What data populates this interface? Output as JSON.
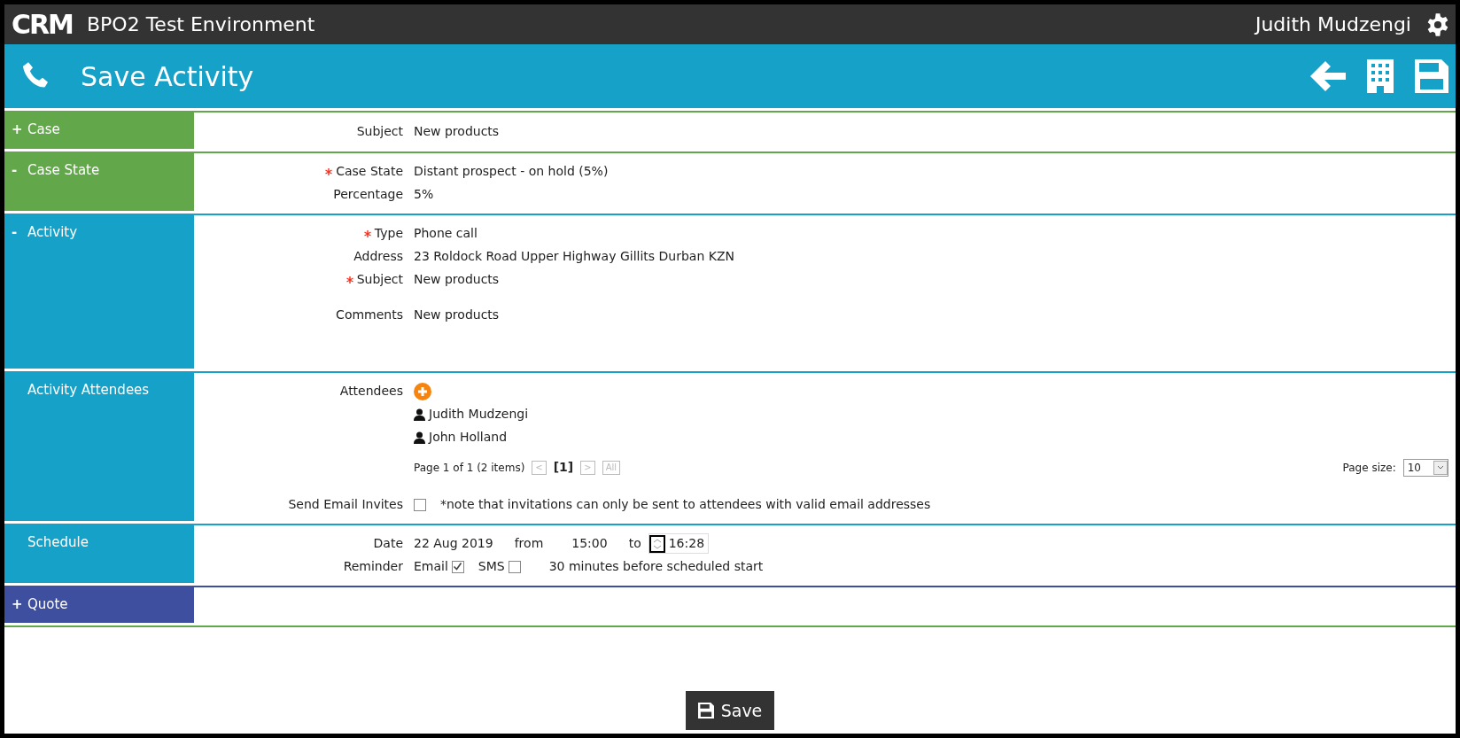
{
  "header": {
    "logo": "CRM",
    "environment": "BPO2 Test Environment",
    "user": "Judith Mudzengi"
  },
  "title_bar": {
    "title": "Save Activity"
  },
  "sections": [
    {
      "title": "Case",
      "toggle": "+",
      "color": "#62a84a",
      "rows": [
        {
          "kind": "field",
          "label": "Subject",
          "required": false,
          "value": "New products"
        }
      ]
    },
    {
      "title": "Case State",
      "toggle": "-",
      "color": "#62a84a",
      "rows": [
        {
          "kind": "field",
          "label": "Case State",
          "required": true,
          "value": "Distant prospect - on hold (5%)"
        },
        {
          "kind": "field",
          "label": "Percentage",
          "required": false,
          "value": "5%"
        }
      ]
    },
    {
      "title": "Activity",
      "toggle": "-",
      "color": "#16a1c9",
      "rows": [
        {
          "kind": "field",
          "label": "Type",
          "required": true,
          "value": "Phone call"
        },
        {
          "kind": "field",
          "label": "Address",
          "required": false,
          "value": "23 Roldock Road Upper Highway Gillits Durban KZN"
        },
        {
          "kind": "field",
          "label": "Subject",
          "required": true,
          "value": "New products"
        },
        {
          "kind": "multiline",
          "label": "Comments",
          "required": false,
          "value": "New products"
        }
      ]
    },
    {
      "title": "Activity Attendees",
      "color": "#16a1c9",
      "rows": [
        {
          "kind": "attendees",
          "label": "Attendees",
          "people": [
            "Judith Mudzengi",
            "John Holland"
          ]
        },
        {
          "kind": "pager",
          "summary": "Page 1 of 1 (2 items)",
          "prev": {
            "text": "<",
            "disabled": true
          },
          "current": "[1]",
          "next": {
            "text": ">",
            "disabled": true
          },
          "all": {
            "text": "All",
            "disabled": true
          },
          "page_size_label": "Page size:",
          "page_size": "10"
        },
        {
          "kind": "invite",
          "label": "Send Email Invites",
          "checked": false,
          "note": "*note that invitations can only be sent to attendees with valid email addresses"
        }
      ]
    },
    {
      "title": "Schedule",
      "color": "#16a1c9",
      "rows": [
        {
          "kind": "time_range",
          "label": "Date",
          "date": "22 Aug 2019",
          "from_label": "from",
          "from": "15:00",
          "to_label": "to",
          "to": "16:28"
        },
        {
          "kind": "reminder",
          "label": "Reminder",
          "options": [
            {
              "label": "Email",
              "checked": true
            },
            {
              "label": "SMS",
              "checked": false
            }
          ],
          "note": "30 minutes before scheduled start"
        }
      ]
    },
    {
      "title": "Quote",
      "toggle": "+",
      "color": "#3f4fa0"
    }
  ],
  "save_button": {
    "label": "Save"
  }
}
